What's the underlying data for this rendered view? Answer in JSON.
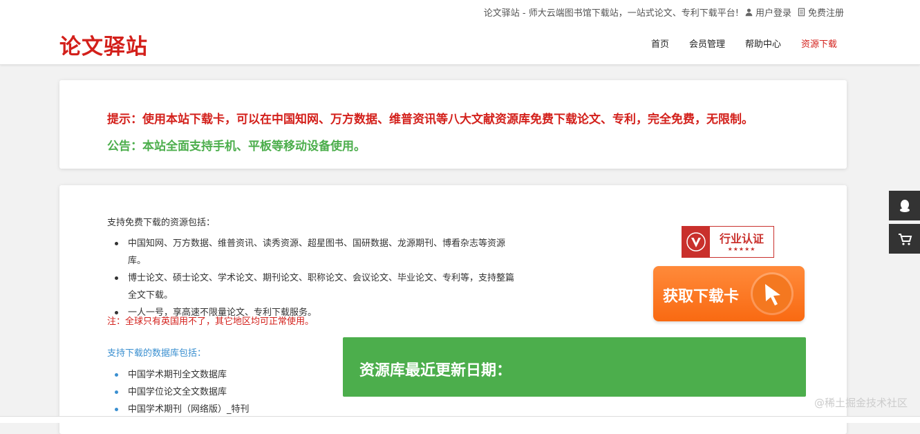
{
  "header": {
    "tagline": "论文驿站 - 师大云端图书馆下载站，一站式论文、专利下载平台!",
    "login_label": "用户登录",
    "register_label": "免费注册",
    "logo": "论文驿站",
    "nav": [
      {
        "label": "首页"
      },
      {
        "label": "会员管理"
      },
      {
        "label": "帮助中心"
      },
      {
        "label": "资源下载"
      }
    ]
  },
  "notice": {
    "tip": "提示：使用本站下载卡，可以在中国知网、万方数据、维普资讯等八大文献资源库免费下载论文、专利，完全免费，无限制。",
    "announcement": "公告：本站全面支持手机、平板等移动设备使用。"
  },
  "main": {
    "resources_heading": "支持免费下载的资源包括：",
    "resources": [
      "中国知网、万方数据、维普资讯、读秀资源、超星图书、国研数据、龙源期刊、博看杂志等资源库。",
      "博士论文、硕士论文、学术论文、期刊论文、职称论文、会议论文、毕业论文、专利等，支持整篇全文下载。",
      "一人一号，享高速不限量论文、专利下载服务。"
    ],
    "note": "注：全球只有英国用不了，其它地区均可正常使用。",
    "db_heading": "支持下载的数据库包括：",
    "databases": [
      "中国学术期刊全文数据库",
      "中国学位论文全文数据库",
      "中国学术期刊（网络版）_特刊"
    ]
  },
  "cert": {
    "title": "行业认证",
    "stars": "★★★★★"
  },
  "get_card_label": "获取下载卡",
  "update_label": "资源库最近更新日期：",
  "watermark": "@稀土掘金技术社区",
  "colors": {
    "brand_red": "#d3201b",
    "green": "#4cae4c",
    "orange": "#f96a12",
    "link_blue": "#3a8fd0",
    "sidebar_dark": "#333333"
  },
  "icons": {
    "login": "user-icon",
    "register": "document-icon",
    "side_top": "qq-icon",
    "side_bottom": "cart-icon"
  }
}
